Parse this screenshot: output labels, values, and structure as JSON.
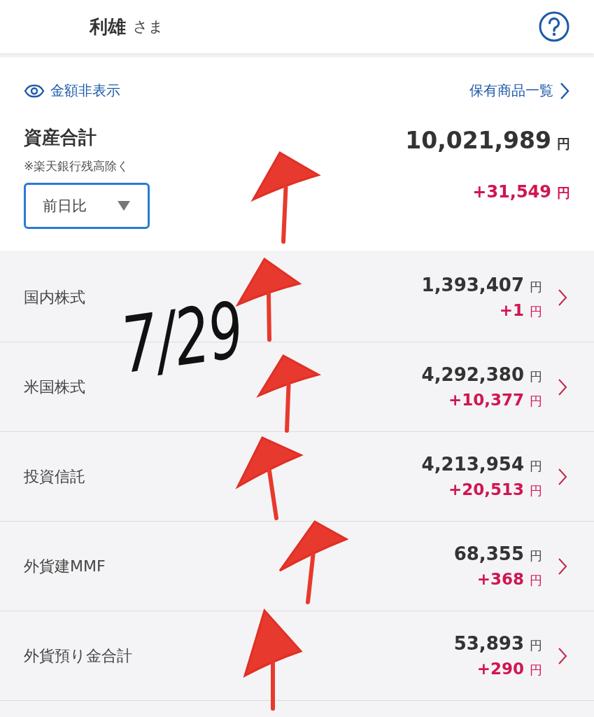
{
  "header": {
    "name": "利雄",
    "honorific": "さま"
  },
  "toolbar": {
    "hide_amounts": "金額非表示",
    "holdings_link": "保有商品一覧"
  },
  "total": {
    "title": "資産合計",
    "note": "※楽天銀行残高除く",
    "period": "前日比",
    "amount": "10,021,989",
    "amount_unit": "円",
    "change": "+31,549",
    "change_unit": "円"
  },
  "categories": [
    {
      "name": "国内株式",
      "amount": "1,393,407",
      "unit": "円",
      "change": "+1",
      "change_unit": "円"
    },
    {
      "name": "米国株式",
      "amount": "4,292,380",
      "unit": "円",
      "change": "+10,377",
      "change_unit": "円"
    },
    {
      "name": "投資信託",
      "amount": "4,213,954",
      "unit": "円",
      "change": "+20,513",
      "change_unit": "円"
    },
    {
      "name": "外貨建MMF",
      "amount": "68,355",
      "unit": "円",
      "change": "+368",
      "change_unit": "円"
    },
    {
      "name": "外貨預り金合計",
      "amount": "53,893",
      "unit": "円",
      "change": "+290",
      "change_unit": "円"
    }
  ],
  "annotation": {
    "text": "7/29"
  }
}
